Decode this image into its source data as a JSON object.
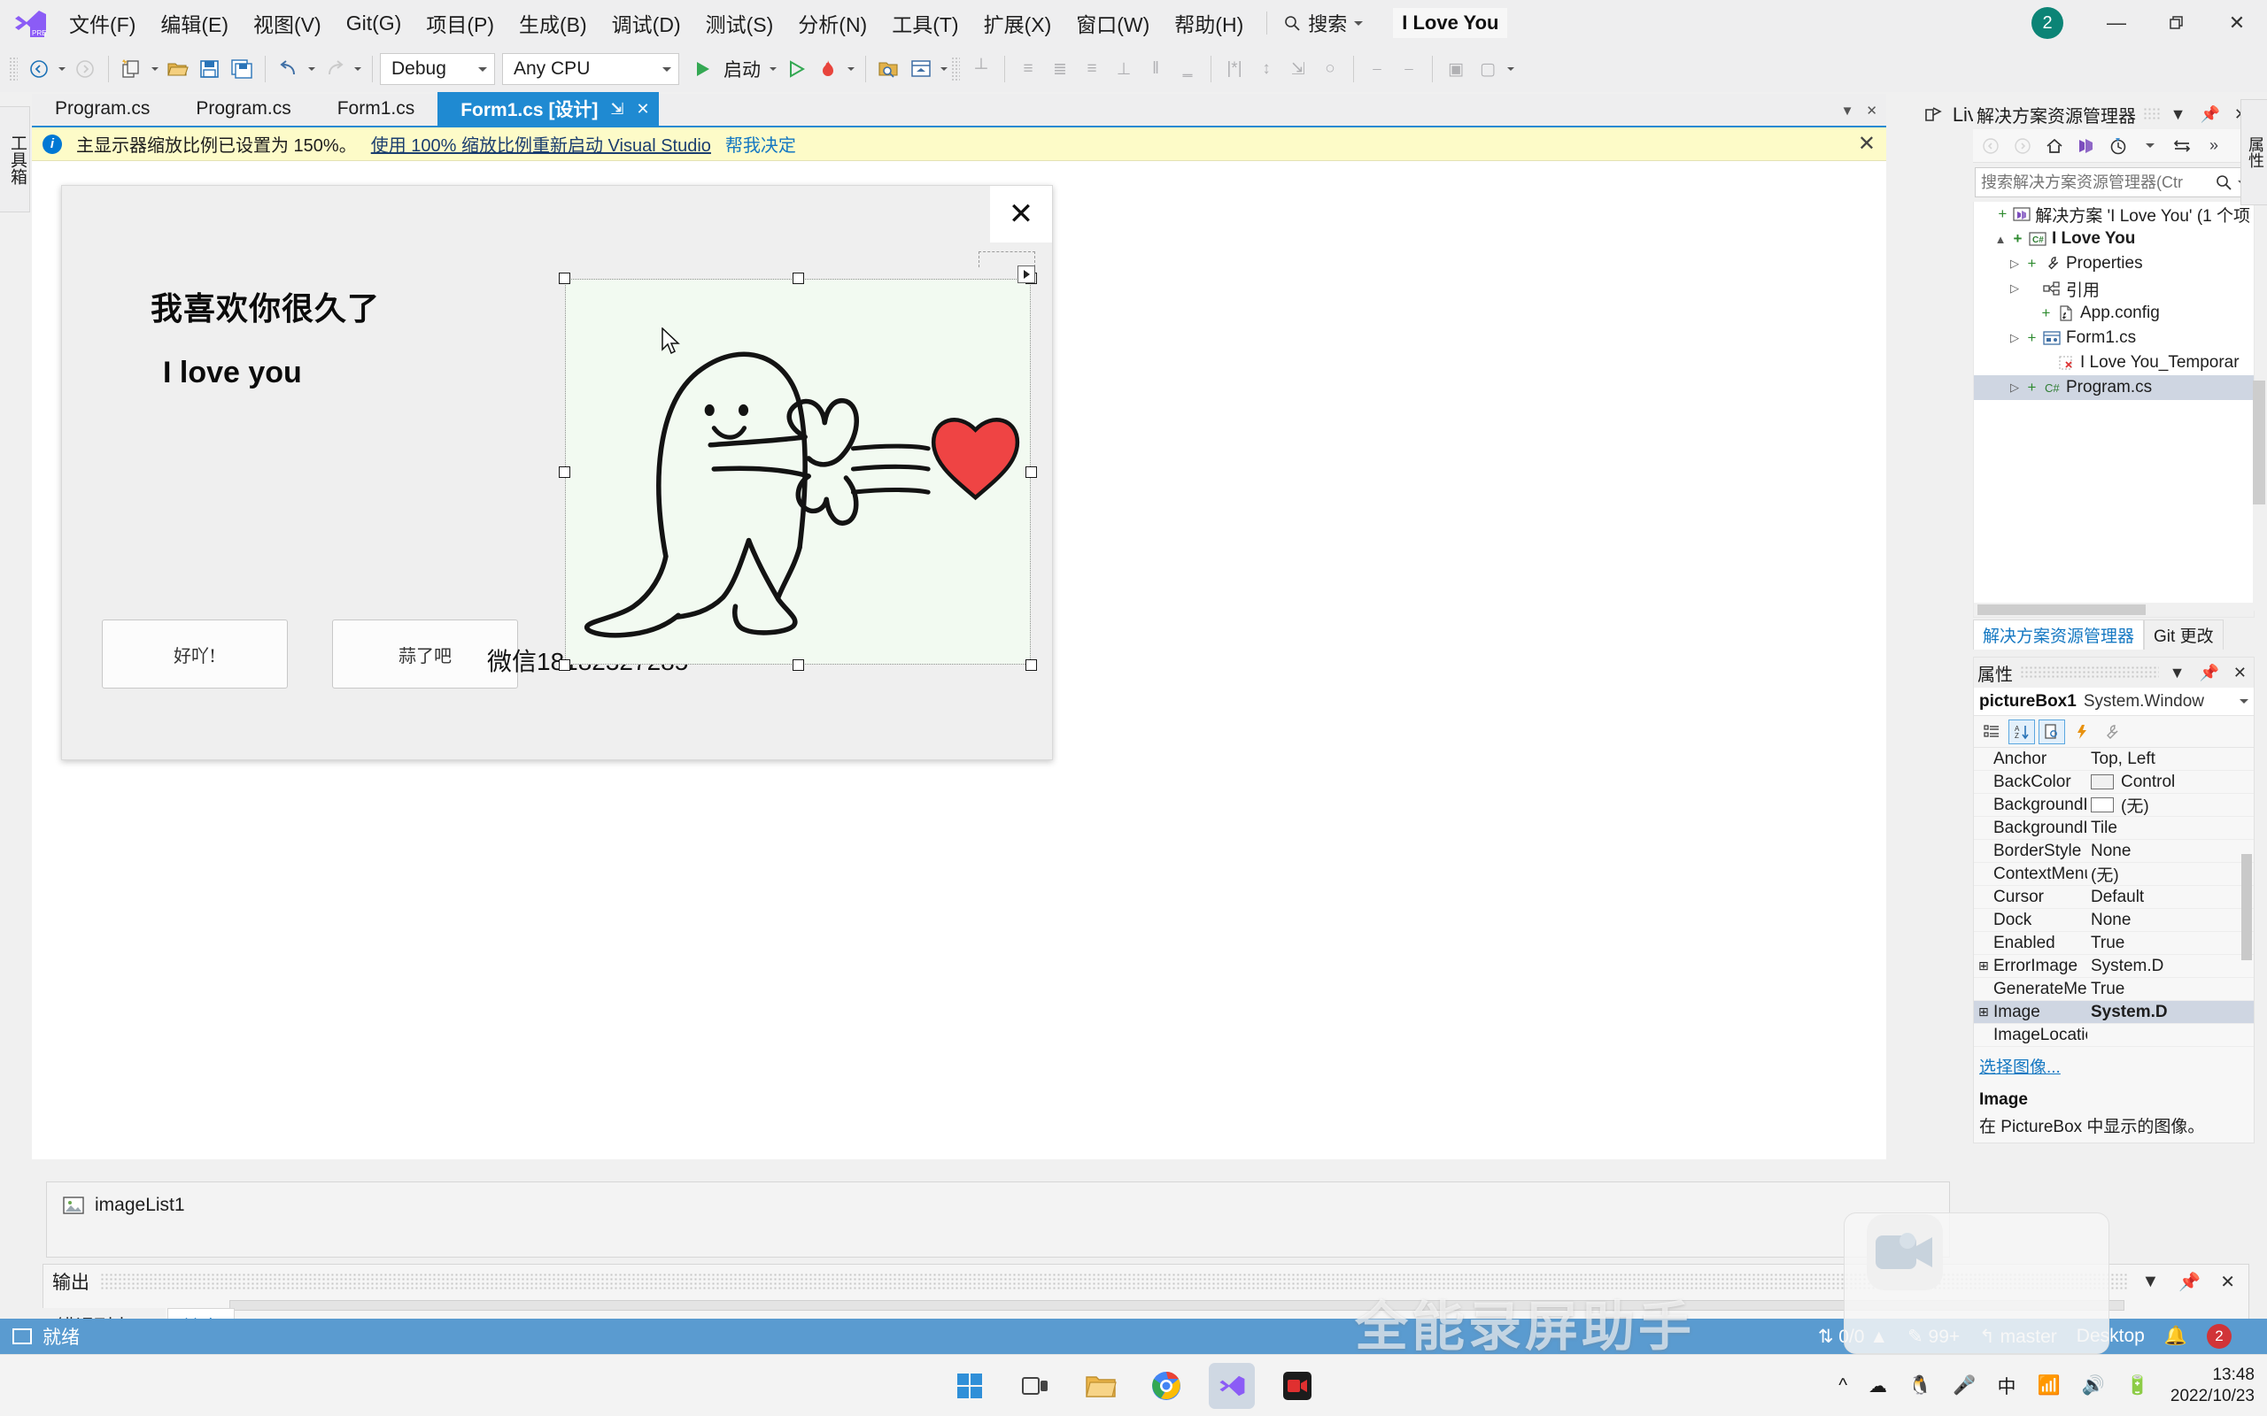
{
  "app": {
    "solution_name": "I Love You",
    "account_badge": "2",
    "live_share": "Live Share",
    "preview_badge": "PREVIEW"
  },
  "menu": {
    "items": [
      "文件(F)",
      "编辑(E)",
      "视图(V)",
      "Git(G)",
      "项目(P)",
      "生成(B)",
      "调试(D)",
      "测试(S)",
      "分析(N)",
      "工具(T)",
      "扩展(X)",
      "窗口(W)",
      "帮助(H)"
    ],
    "search_label": "搜索"
  },
  "toolbar": {
    "config": "Debug",
    "platform": "Any CPU",
    "run_label": "启动"
  },
  "left_vtabs": [
    "工具箱"
  ],
  "right_vtabs": [
    "属性"
  ],
  "tabs": [
    {
      "label": "Program.cs",
      "active": false
    },
    {
      "label": "Program.cs",
      "active": false
    },
    {
      "label": "Form1.cs",
      "active": false
    },
    {
      "label": "Form1.cs [设计]",
      "active": true
    }
  ],
  "infobar": {
    "message": "主显示器缩放比例已设置为 150%。",
    "link": "使用 100% 缩放比例重新启动 Visual Studio",
    "link2": "帮我决定",
    "close": "✕"
  },
  "form": {
    "close_glyph": "✕",
    "heading_cn": "我喜欢你很久了",
    "heading_en": "I love you",
    "button_yes": "好吖!",
    "button_no": "蒜了吧",
    "wechat": "微信18182327285",
    "picture_bg": "#f2faf1",
    "heart_color": "#ef4444"
  },
  "tray": {
    "item": "imageList1"
  },
  "output": {
    "title": "输出",
    "tabs": [
      {
        "label": "错误列表 ...",
        "active": false
      },
      {
        "label": "输出",
        "active": true
      }
    ]
  },
  "solution_explorer": {
    "title": "解决方案资源管理器",
    "search_placeholder": "搜索解决方案资源管理器(Ctr",
    "tree": [
      {
        "label": "解决方案 'I Love You' (1 个项",
        "depth": 0,
        "icon": "solution-icon",
        "twisty": "",
        "plus": true,
        "bold": false,
        "selected": false
      },
      {
        "label": "I Love You",
        "depth": 1,
        "icon": "csharp-project-icon",
        "twisty": "▲",
        "plus": true,
        "bold": true,
        "selected": false
      },
      {
        "label": "Properties",
        "depth": 2,
        "icon": "wrench-icon",
        "twisty": "▷",
        "plus": true,
        "bold": false,
        "selected": false
      },
      {
        "label": "引用",
        "depth": 2,
        "icon": "references-icon",
        "twisty": "▷",
        "plus": false,
        "bold": false,
        "selected": false
      },
      {
        "label": "App.config",
        "depth": 3,
        "icon": "config-file-icon",
        "twisty": "",
        "plus": true,
        "bold": false,
        "selected": false
      },
      {
        "label": "Form1.cs",
        "depth": 2,
        "icon": "form-icon",
        "twisty": "▷",
        "plus": true,
        "bold": false,
        "selected": false
      },
      {
        "label": "I Love You_Temporar",
        "depth": 3,
        "icon": "locked-file-icon",
        "twisty": "",
        "plus": false,
        "bold": false,
        "selected": false
      },
      {
        "label": "Program.cs",
        "depth": 2,
        "icon": "csharp-file-icon",
        "twisty": "▷",
        "plus": true,
        "bold": false,
        "selected": true
      }
    ],
    "dock_tabs": [
      {
        "label": "解决方案资源管理器",
        "active": true
      },
      {
        "label": "Git 更改",
        "active": false
      }
    ]
  },
  "properties": {
    "title": "属性",
    "object_name": "pictureBox1",
    "object_type": "System.Window",
    "rows": [
      {
        "key": "Anchor",
        "value": "Top, Left",
        "expander": "",
        "swatch": null,
        "bold": false,
        "selected": false
      },
      {
        "key": "BackColor",
        "value": "Control",
        "expander": "",
        "swatch": "#f0f0f0",
        "bold": false,
        "selected": false
      },
      {
        "key": "BackgroundI",
        "value": "(无)",
        "expander": "",
        "swatch": "#ffffff",
        "bold": false,
        "selected": false
      },
      {
        "key": "BackgroundI",
        "value": "Tile",
        "expander": "",
        "swatch": null,
        "bold": false,
        "selected": false
      },
      {
        "key": "BorderStyle",
        "value": "None",
        "expander": "",
        "swatch": null,
        "bold": false,
        "selected": false
      },
      {
        "key": "ContextMenu",
        "value": "(无)",
        "expander": "",
        "swatch": null,
        "bold": false,
        "selected": false
      },
      {
        "key": "Cursor",
        "value": "Default",
        "expander": "",
        "swatch": null,
        "bold": false,
        "selected": false
      },
      {
        "key": "Dock",
        "value": "None",
        "expander": "",
        "swatch": null,
        "bold": false,
        "selected": false
      },
      {
        "key": "Enabled",
        "value": "True",
        "expander": "",
        "swatch": null,
        "bold": false,
        "selected": false
      },
      {
        "key": "ErrorImage",
        "value": "System.D",
        "expander": "⊞",
        "swatch": null,
        "bold": false,
        "selected": false
      },
      {
        "key": "GenerateMer",
        "value": "True",
        "expander": "",
        "swatch": null,
        "bold": false,
        "selected": false
      },
      {
        "key": "Image",
        "value": "System.D",
        "expander": "⊞",
        "swatch": null,
        "bold": true,
        "selected": true
      },
      {
        "key": "ImageLocatio",
        "value": "",
        "expander": "",
        "swatch": null,
        "bold": false,
        "selected": false
      }
    ],
    "choose_image_link": "选择图像...",
    "help_title": "Image",
    "help_desc": "在 PictureBox 中显示的图像。"
  },
  "statusbar": {
    "ready": "就绪",
    "sync": "0/0",
    "pending_edits": "99+",
    "branch": "master",
    "repo": "Desktop",
    "notifications": "2"
  },
  "watermark": "全能录屏助手",
  "taskbar": {
    "clock_time": "13:48",
    "clock_date": "2022/10/23",
    "ime": "中"
  }
}
